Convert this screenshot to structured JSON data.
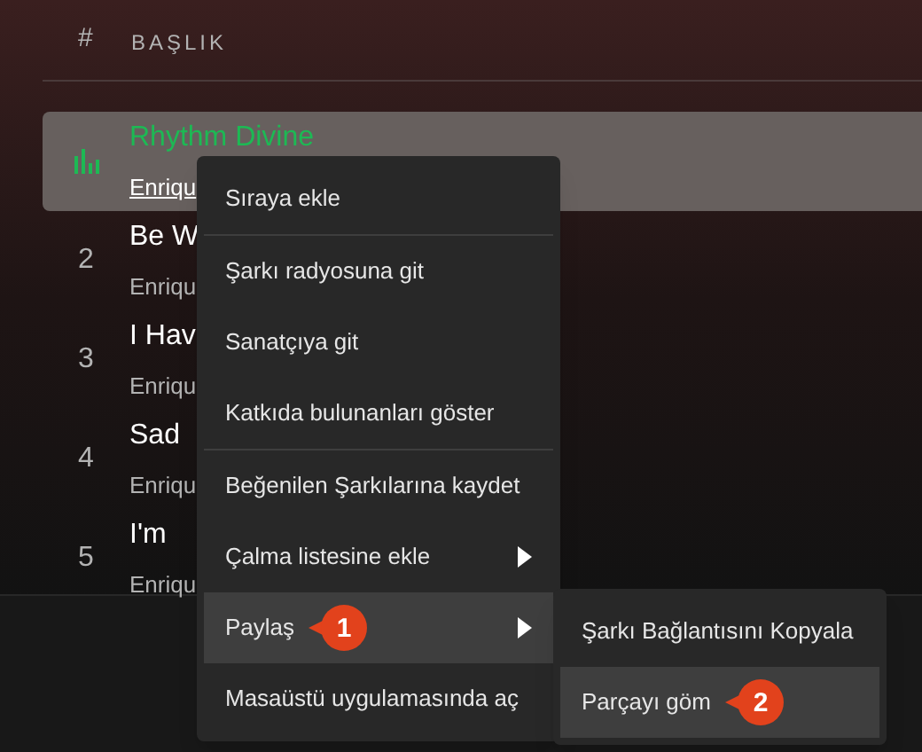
{
  "header": {
    "number": "#",
    "title": "BAŞLIK"
  },
  "tracks": [
    {
      "title": "Rhythm Divine",
      "artist": "Enriqu",
      "playing": true,
      "selected": true
    },
    {
      "number": "2",
      "title": "Be W",
      "artist": "Enriqu",
      "playing": false,
      "selected": false
    },
    {
      "number": "3",
      "title": "I Hav",
      "artist": "Enriqu",
      "playing": false,
      "selected": false
    },
    {
      "number": "4",
      "title": "Sad",
      "artist": "Enriqu",
      "playing": false,
      "selected": false
    },
    {
      "number": "5",
      "title": "I'm",
      "artist": "Enriqu",
      "playing": false,
      "selected": false
    }
  ],
  "context_menu": {
    "groups": [
      [
        {
          "label": "Sıraya ekle",
          "submenu": false,
          "selected": false
        }
      ],
      [
        {
          "label": "Şarkı radyosuna git",
          "submenu": false,
          "selected": false
        },
        {
          "label": "Sanatçıya git",
          "submenu": false,
          "selected": false
        },
        {
          "label": "Katkıda bulunanları göster",
          "submenu": false,
          "selected": false
        }
      ],
      [
        {
          "label": "Beğenilen Şarkılarına kaydet",
          "submenu": false,
          "selected": false
        },
        {
          "label": "Çalma listesine ekle",
          "submenu": true,
          "selected": false
        },
        {
          "label": "Paylaş",
          "submenu": true,
          "selected": true,
          "badge": "1"
        },
        {
          "label": "Masaüstü uygulamasında aç",
          "submenu": false,
          "selected": false
        }
      ]
    ]
  },
  "submenu": {
    "items": [
      {
        "label": "Şarkı Bağlantısını Kopyala",
        "selected": false
      },
      {
        "label": "Parçayı göm",
        "selected": true,
        "badge": "2"
      }
    ]
  }
}
